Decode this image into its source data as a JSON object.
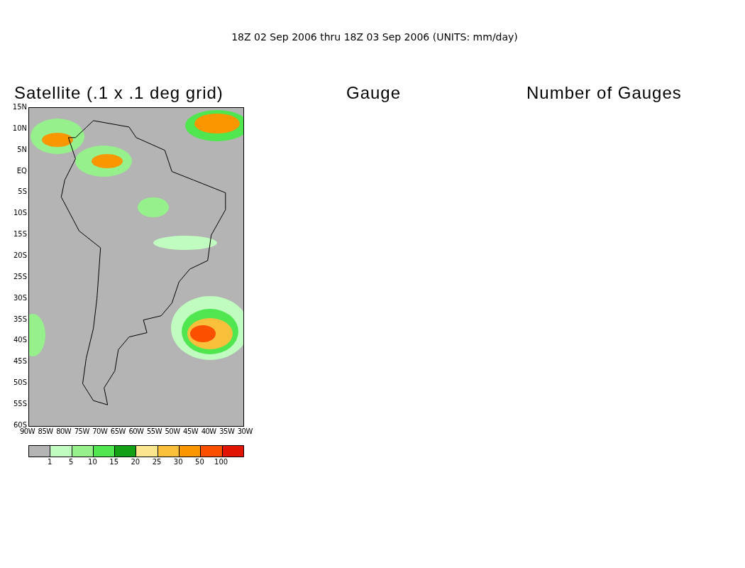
{
  "title": "18Z 02 Sep 2006 thru 18Z 03 Sep 2006 (UNITS: mm/day)",
  "panel_titles": [
    "Satellite (.1 x .1 deg grid)",
    "Gauge",
    "Number of Gauges"
  ],
  "map": {
    "lat_labels": [
      "15N",
      "10N",
      "5N",
      "EQ",
      "5S",
      "10S",
      "15S",
      "20S",
      "25S",
      "30S",
      "35S",
      "40S",
      "45S",
      "50S",
      "55S",
      "60S"
    ],
    "lon_labels": [
      "90W",
      "85W",
      "80W",
      "75W",
      "70W",
      "65W",
      "60W",
      "55W",
      "50W",
      "45W",
      "40W",
      "35W",
      "30W"
    ]
  },
  "colorbar": {
    "segments": [
      {
        "color": "#b4b4b4"
      },
      {
        "color": "#c0fcc0"
      },
      {
        "color": "#96f08c"
      },
      {
        "color": "#50e650"
      },
      {
        "color": "#14a014"
      },
      {
        "color": "#fae68c"
      },
      {
        "color": "#fac03c"
      },
      {
        "color": "#fa9600"
      },
      {
        "color": "#fa5000"
      },
      {
        "color": "#e11400"
      }
    ],
    "labels": [
      "1",
      "5",
      "10",
      "15",
      "20",
      "25",
      "30",
      "50",
      "100"
    ]
  }
}
